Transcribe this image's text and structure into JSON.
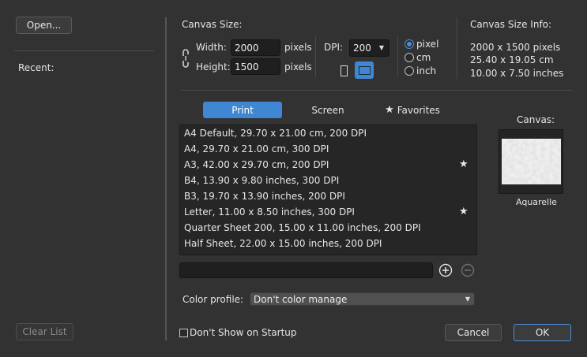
{
  "sidebar": {
    "open_label": "Open...",
    "recent_label": "Recent:",
    "clear_list_label": "Clear List"
  },
  "canvas_size": {
    "title": "Canvas Size:",
    "width_label": "Width:",
    "width_value": "2000",
    "width_unit": "pixels",
    "height_label": "Height:",
    "height_value": "1500",
    "height_unit": "pixels",
    "dpi_label": "DPI:",
    "dpi_value": "200",
    "units": [
      {
        "label": "pixel",
        "selected": true
      },
      {
        "label": "cm",
        "selected": false
      },
      {
        "label": "inch",
        "selected": false
      }
    ],
    "orientation": "landscape"
  },
  "canvas_info": {
    "title": "Canvas Size Info:",
    "pixels": "2000 x 1500 pixels",
    "cm": "25.40 x 19.05 cm",
    "inches": "10.00 x 7.50 inches"
  },
  "tabs": [
    {
      "label": "Print",
      "active": true
    },
    {
      "label": "Screen",
      "active": false
    },
    {
      "label": "Favorites",
      "active": false,
      "icon": "star-icon"
    }
  ],
  "presets": [
    {
      "label": "A4 Default, 29.70 x 21.00 cm, 200 DPI",
      "favorite": false
    },
    {
      "label": "A4, 29.70 x 21.00 cm, 300 DPI",
      "favorite": false
    },
    {
      "label": "A3, 42.00 x 29.70 cm, 200 DPI",
      "favorite": true
    },
    {
      "label": "B4, 13.90 x 9.80 inches, 300 DPI",
      "favorite": false
    },
    {
      "label": "B3, 19.70 x 13.90 inches, 200 DPI",
      "favorite": false
    },
    {
      "label": "Letter, 11.00 x 8.50 inches, 300 DPI",
      "favorite": true
    },
    {
      "label": "Quarter Sheet 200, 15.00 x 11.00 inches, 200 DPI",
      "favorite": false
    },
    {
      "label": "Half Sheet, 22.00 x 15.00 inches, 200 DPI",
      "favorite": false
    }
  ],
  "preset_name_value": "",
  "canvas_preview": {
    "title": "Canvas:",
    "texture_name": "Aquarelle"
  },
  "color_profile": {
    "label": "Color profile:",
    "value": "Don't color manage"
  },
  "footer": {
    "dont_show_label": "Don't Show on Startup",
    "dont_show_checked": false,
    "cancel_label": "Cancel",
    "ok_label": "OK"
  },
  "colors": {
    "background": "#323232",
    "accent": "#3f87d2"
  }
}
